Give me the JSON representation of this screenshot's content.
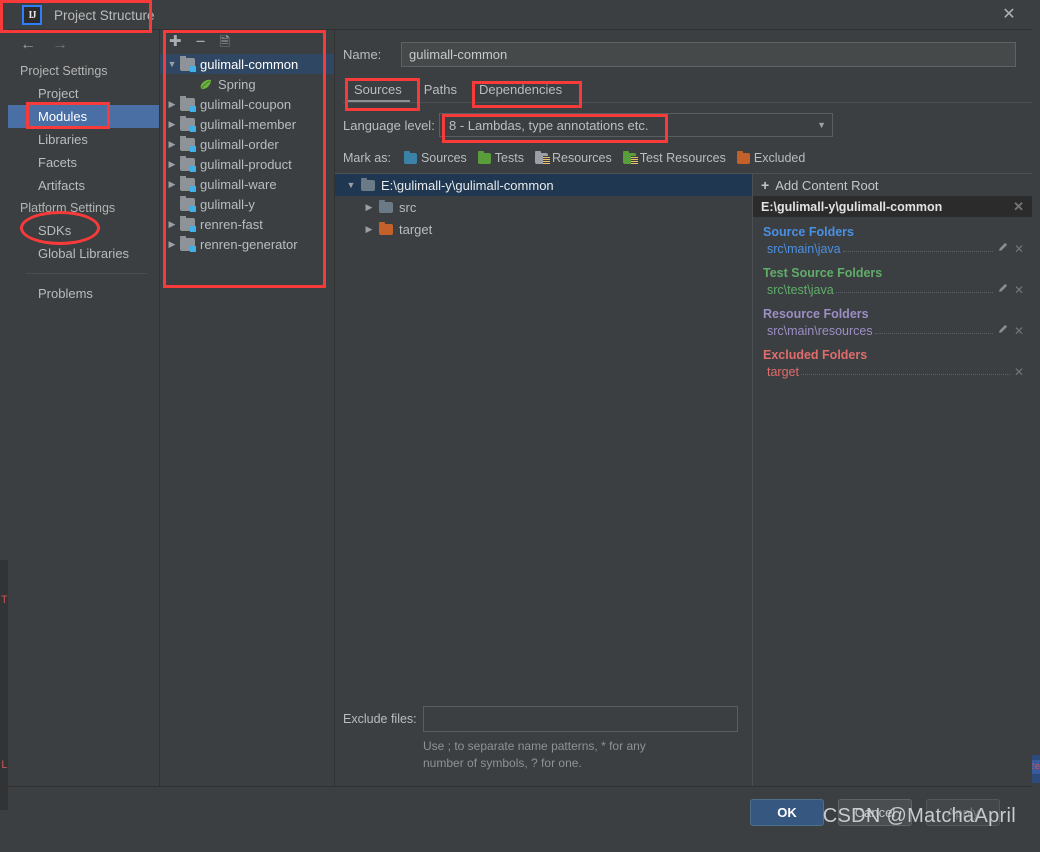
{
  "window": {
    "title": "Project Structure",
    "logo_text": "IJ",
    "close_icon": "close-icon"
  },
  "nav": {
    "back_icon": "arrow-left-icon",
    "forward_icon": "arrow-right-icon",
    "groups": [
      {
        "label": "Project Settings",
        "items": [
          {
            "label": "Project",
            "selected": false
          },
          {
            "label": "Modules",
            "selected": true
          },
          {
            "label": "Libraries",
            "selected": false
          },
          {
            "label": "Facets",
            "selected": false
          },
          {
            "label": "Artifacts",
            "selected": false
          }
        ]
      },
      {
        "label": "Platform Settings",
        "items": [
          {
            "label": "SDKs",
            "selected": false
          },
          {
            "label": "Global Libraries",
            "selected": false
          }
        ]
      }
    ],
    "problems_label": "Problems"
  },
  "modules_panel": {
    "toolbar": {
      "add_icon": "plus-icon",
      "remove_icon": "minus-icon",
      "copy_icon": "copy-module-icon"
    },
    "tree": [
      {
        "label": "gulimall-common",
        "type": "module",
        "expanded": true,
        "selected": true,
        "indent": 0
      },
      {
        "label": "Spring",
        "type": "facet",
        "expanded": null,
        "selected": false,
        "indent": 1
      },
      {
        "label": "gulimall-coupon",
        "type": "module",
        "expanded": false,
        "selected": false,
        "indent": 0
      },
      {
        "label": "gulimall-member",
        "type": "module",
        "expanded": false,
        "selected": false,
        "indent": 0
      },
      {
        "label": "gulimall-order",
        "type": "module",
        "expanded": false,
        "selected": false,
        "indent": 0
      },
      {
        "label": "gulimall-product",
        "type": "module",
        "expanded": false,
        "selected": false,
        "indent": 0
      },
      {
        "label": "gulimall-ware",
        "type": "module",
        "expanded": false,
        "selected": false,
        "indent": 0
      },
      {
        "label": "gulimall-y",
        "type": "module",
        "expanded": null,
        "selected": false,
        "indent": 0
      },
      {
        "label": "renren-fast",
        "type": "module",
        "expanded": false,
        "selected": false,
        "indent": 0
      },
      {
        "label": "renren-generator",
        "type": "module",
        "expanded": false,
        "selected": false,
        "indent": 0
      }
    ]
  },
  "main": {
    "name_label": "Name:",
    "name_value": "gulimall-common",
    "tabs": [
      {
        "label": "Sources",
        "active": true
      },
      {
        "label": "Paths",
        "active": false
      },
      {
        "label": "Dependencies",
        "active": false
      }
    ],
    "language_level_label": "Language level:",
    "language_level_value": "8 - Lambdas, type annotations etc.",
    "combo_caret_icon": "chevron-down-icon",
    "mark_as_label": "Mark as:",
    "mark_as_items": [
      {
        "label": "Sources",
        "color": "#3b82a8",
        "resource": false
      },
      {
        "label": "Tests",
        "color": "#5a9e3c",
        "resource": false
      },
      {
        "label": "Resources",
        "color": "#9aa0a6",
        "resource": true
      },
      {
        "label": "Test Resources",
        "color": "#5a9e3c",
        "resource": true
      },
      {
        "label": "Excluded",
        "color": "#c4602a",
        "resource": false
      }
    ],
    "content_tree": [
      {
        "label": "E:\\gulimall-y\\gulimall-common",
        "expanded": true,
        "selected": true,
        "indent": 0,
        "color": "#6a7a86"
      },
      {
        "label": "src",
        "expanded": false,
        "selected": false,
        "indent": 1,
        "color": "#6a7a86"
      },
      {
        "label": "target",
        "expanded": false,
        "selected": false,
        "indent": 1,
        "color": "#c4602a"
      }
    ],
    "exclude_files_label": "Exclude files:",
    "exclude_files_value": "",
    "exclude_hint_line1": "Use ; to separate name patterns, * for any number of",
    "exclude_hint_line2": "symbols, ? for one."
  },
  "roots_panel": {
    "add_content_root_label": "Add Content Root",
    "add_icon": "plus-icon",
    "content_root": "E:\\gulimall-y\\gulimall-common",
    "close_icon": "close-icon",
    "sections": [
      {
        "title": "Source Folders",
        "color": "#4a90e2",
        "items": [
          {
            "path": "src\\main\\java",
            "editable": true
          }
        ]
      },
      {
        "title": "Test Source Folders",
        "color": "#60ad6a",
        "items": [
          {
            "path": "src\\test\\java",
            "editable": true
          }
        ]
      },
      {
        "title": "Resource Folders",
        "color": "#9b8ec4",
        "items": [
          {
            "path": "src\\main\\resources",
            "editable": true
          }
        ]
      },
      {
        "title": "Excluded Folders",
        "color": "#e06c6c",
        "items": [
          {
            "path": "target",
            "editable": false
          }
        ]
      }
    ],
    "edit_icon": "pencil-icon",
    "remove_icon": "close-icon"
  },
  "footer": {
    "ok_label": "OK",
    "cancel_label": "Cancel",
    "apply_label": "Apply"
  },
  "watermark": "CSDN @MatchaApril",
  "ide_background": {
    "left_marks": [
      "T",
      "L"
    ],
    "right_mark": "2e"
  },
  "colors": {
    "dialog_bg": "#3c3f41",
    "selection_blue": "#4a6fa5",
    "tree_selection": "#2f4763",
    "annotation_red": "#f83a3a",
    "ok_button": "#365880"
  }
}
